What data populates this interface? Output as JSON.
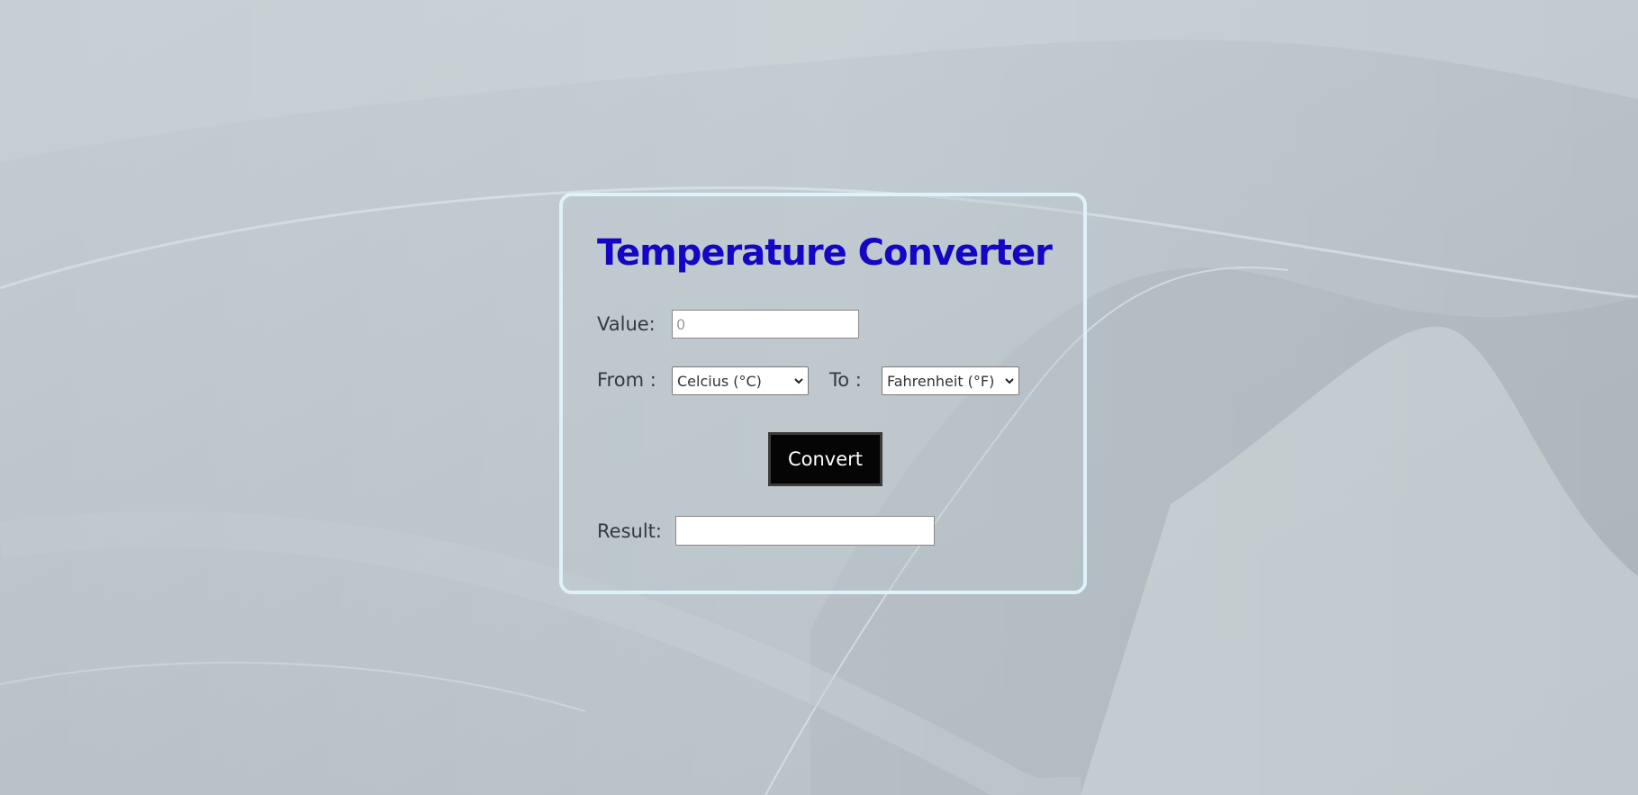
{
  "app": {
    "title": "Temperature Converter"
  },
  "form": {
    "value_label": "Value:",
    "value_placeholder": "0",
    "value": "",
    "from_label": "From :",
    "from_selected": "Celcius (°C)",
    "to_label": "To :",
    "to_selected": "Fahrenheit (°F)",
    "convert_label": "Convert",
    "result_label": "Result:",
    "result_value": ""
  },
  "colors": {
    "title": "#1406c4",
    "card_border": "#dff1f9",
    "button_bg": "#050505",
    "button_text": "#ffffff",
    "label": "#333a40",
    "background": "#b9c3c9"
  },
  "icons": {
    "select_arrow": "chevron-down-icon"
  }
}
